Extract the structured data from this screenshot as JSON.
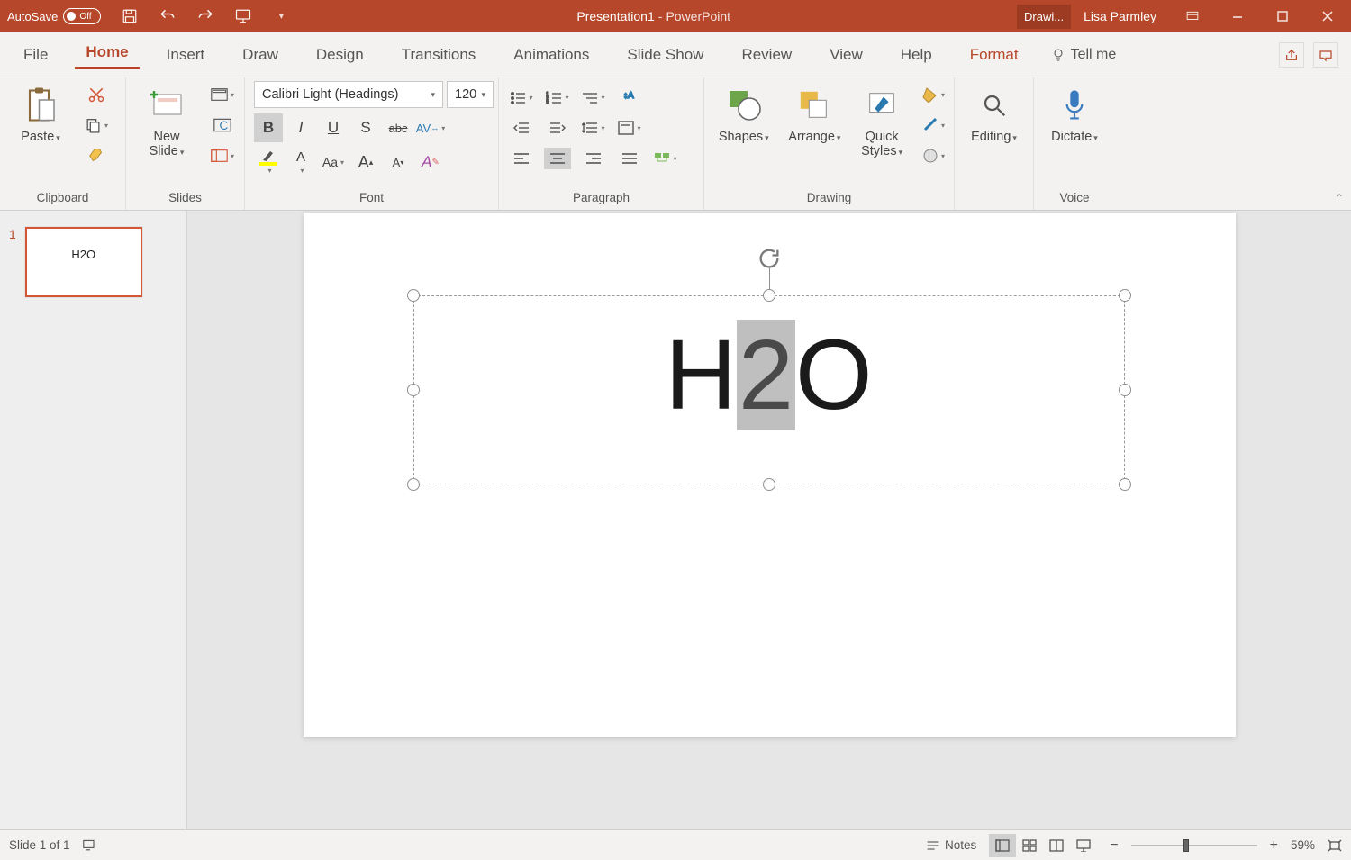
{
  "titlebar": {
    "autosave_label": "AutoSave",
    "autosave_state": "Off",
    "document": "Presentation1",
    "app": "PowerPoint",
    "contextual": "Drawi...",
    "user": "Lisa Parmley"
  },
  "tabs": {
    "file": "File",
    "home": "Home",
    "insert": "Insert",
    "draw": "Draw",
    "design": "Design",
    "transitions": "Transitions",
    "animations": "Animations",
    "slideshow": "Slide Show",
    "review": "Review",
    "view": "View",
    "help": "Help",
    "format": "Format",
    "tellme": "Tell me"
  },
  "ribbon": {
    "clipboard": {
      "group": "Clipboard",
      "paste": "Paste"
    },
    "slides": {
      "group": "Slides",
      "new_slide_l1": "New",
      "new_slide_l2": "Slide"
    },
    "font": {
      "group": "Font",
      "name": "Calibri Light (Headings)",
      "size": "120",
      "bold": "B",
      "italic": "I",
      "underline": "U",
      "shadow": "S",
      "strike": "abc",
      "av": "AV",
      "aa": "Aa",
      "grow": "A",
      "shrink": "A",
      "clear": "A"
    },
    "paragraph": {
      "group": "Paragraph"
    },
    "drawing": {
      "group": "Drawing",
      "shapes": "Shapes",
      "arrange": "Arrange",
      "quick_l1": "Quick",
      "quick_l2": "Styles"
    },
    "editing": {
      "group": "",
      "label": "Editing"
    },
    "voice": {
      "group": "Voice",
      "dictate": "Dictate"
    }
  },
  "thumbs": {
    "num": "1",
    "text": "H2O"
  },
  "slide": {
    "h": "H",
    "two": "2",
    "o": "O"
  },
  "status": {
    "slide": "Slide 1 of 1",
    "notes": "Notes",
    "zoom": "59%"
  }
}
